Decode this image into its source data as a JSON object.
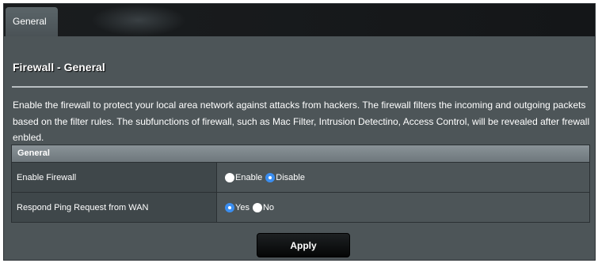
{
  "tabs": [
    {
      "label": "General",
      "active": true
    }
  ],
  "page": {
    "title": "Firewall - General",
    "description": "Enable the firewall to protect your local area network against attacks from hackers. The firewall filters the incoming and outgoing packets based on the filter rules. The subfunctions of firewall, such as Mac Filter, Intrusion Detectino, Access Control, will be revealed after frewall enbled."
  },
  "section": {
    "header": "General",
    "rows": [
      {
        "label": "Enable Firewall",
        "options": [
          {
            "label": "Enable",
            "selected": false
          },
          {
            "label": "Disable",
            "selected": true
          }
        ]
      },
      {
        "label": "Respond Ping Request from WAN",
        "options": [
          {
            "label": "Yes",
            "selected": true
          },
          {
            "label": "No",
            "selected": false
          }
        ]
      }
    ]
  },
  "actions": {
    "apply_label": "Apply"
  },
  "colors": {
    "radio_selected": "#3b8ef0",
    "panel": "#4d5558",
    "topbar": "#1a1d1f"
  }
}
